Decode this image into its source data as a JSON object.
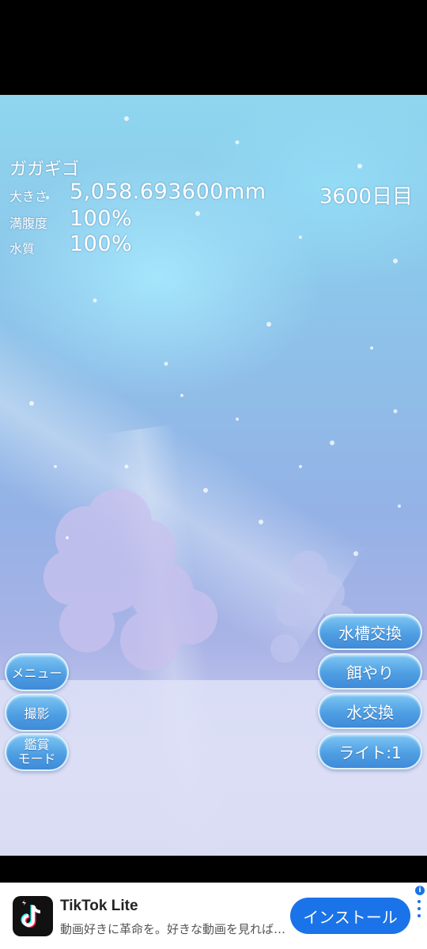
{
  "hud": {
    "fish_name": "ガガギゴ",
    "size_label": "大きさ",
    "size_value": "5,058.693600mm",
    "day": "3600日目",
    "fullness_label": "満腹度",
    "fullness_value": "100%",
    "water_label": "水質",
    "water_value": "100%"
  },
  "left_buttons": {
    "menu": "メニュー",
    "photo": "撮影",
    "view_mode_line1": "鑑賞",
    "view_mode_line2": "モード"
  },
  "right_buttons": {
    "tank_change": "水槽交換",
    "feed": "餌やり",
    "water_change": "水交換",
    "light": "ライト:1"
  },
  "ad": {
    "app_name": "TikTok Lite",
    "description": "動画好きに革命を。好きな動画を見れば…",
    "install_label": "インストール",
    "info_glyph": "i",
    "logo_icon": "tiktok-logo-icon"
  },
  "colors": {
    "button_blue": "#4f9fe3",
    "ad_button": "#1a73e8"
  }
}
